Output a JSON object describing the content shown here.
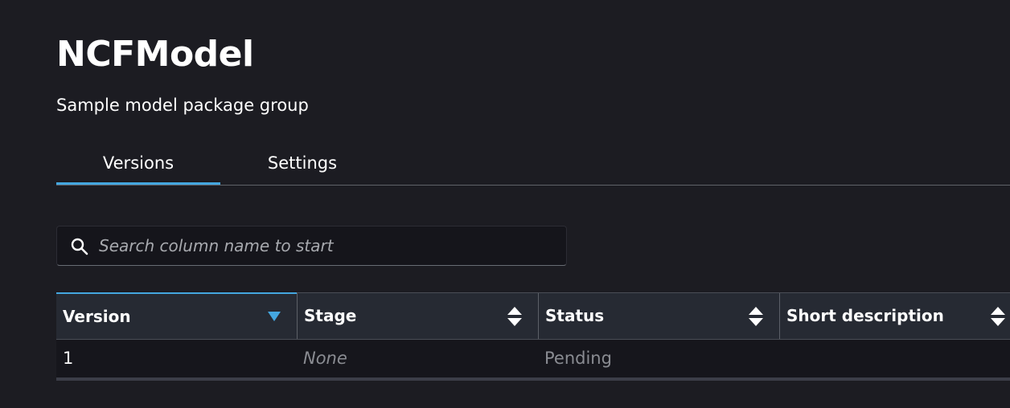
{
  "header": {
    "title": "NCFModel",
    "subtitle": "Sample model package group"
  },
  "tabs": [
    {
      "label": "Versions",
      "active": true
    },
    {
      "label": "Settings",
      "active": false
    }
  ],
  "search": {
    "placeholder": "Search column name to start",
    "value": "",
    "icon": "search-icon"
  },
  "table": {
    "columns": [
      {
        "label": "Version",
        "sort": "descending"
      },
      {
        "label": "Stage",
        "sort": "none"
      },
      {
        "label": "Status",
        "sort": "none"
      },
      {
        "label": "Short description",
        "sort": "none"
      }
    ],
    "rows": [
      {
        "version": "1",
        "stage": "None",
        "status": "Pending",
        "description": ""
      }
    ]
  },
  "colors": {
    "background": "#1c1c22",
    "accent": "#44a7e0",
    "header_bg": "#262a33",
    "muted_text": "#8a8c92"
  }
}
